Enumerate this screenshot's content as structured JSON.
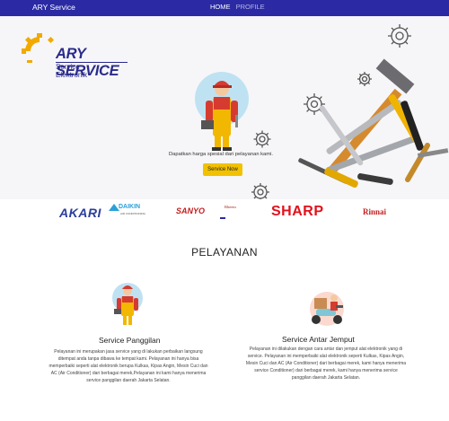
{
  "navbar": {
    "brand": "ARY Service",
    "links": [
      {
        "label": "HOME",
        "active": true
      },
      {
        "label": "PROFILE",
        "active": false
      }
    ]
  },
  "logo": {
    "title": "ARY SERVICE",
    "subtitle": "Service Elektronik"
  },
  "hero": {
    "caption": "Dapatkan harga spesial dari pelayanan kami.",
    "button": "Service Now",
    "button_color": "#f2c100"
  },
  "brands": [
    "AKARI",
    "DAIKIN",
    "SANYO",
    "Rheem",
    "SHARP",
    "Rinnai"
  ],
  "brands_extra": {
    "daikin_sub": "AIR CONDITIONING",
    "rheem_sub": "Rheem"
  },
  "section": {
    "title": "PELAYANAN",
    "services": [
      {
        "title": "Service Panggilan",
        "icon": "technician-icon",
        "desc": "Pelayanan ini merupakan jasa service yang di lakukan perbaikan langsung ditempat anda tanpa dibawa ke tempat kami. Pelayanan ini hanya bisa memperbaiki seperti alat elektronik berupa Kulkas, Kipas Angin, Mesin Cuci dan AC (Air Conditioner) dari berbagai merek,Pelayanan ini kami hanya menerima service panggilan daerah Jakarta Selatan."
      },
      {
        "title": "Service Antar Jemput",
        "icon": "delivery-scooter-icon",
        "desc": "Pelayanan ini dilakukan dengan cara antar dan jemput alat elektronik yang di service. Pelayanan ini memperbaiki alat elektronik seperti Kulkas, Kipas Angin, Mesin Cuci dan AC (Air Conditioner) dari berbagai merek, kami hanya menerima service Conditioner) dari berbagai merek, kami hanya menerima service panggilan daerah Jakarta Selatan."
      }
    ]
  },
  "colors": {
    "navbar": "#2b2aa4",
    "logo_blue": "#2a2b8a",
    "logo_gear": "#f2a900"
  }
}
